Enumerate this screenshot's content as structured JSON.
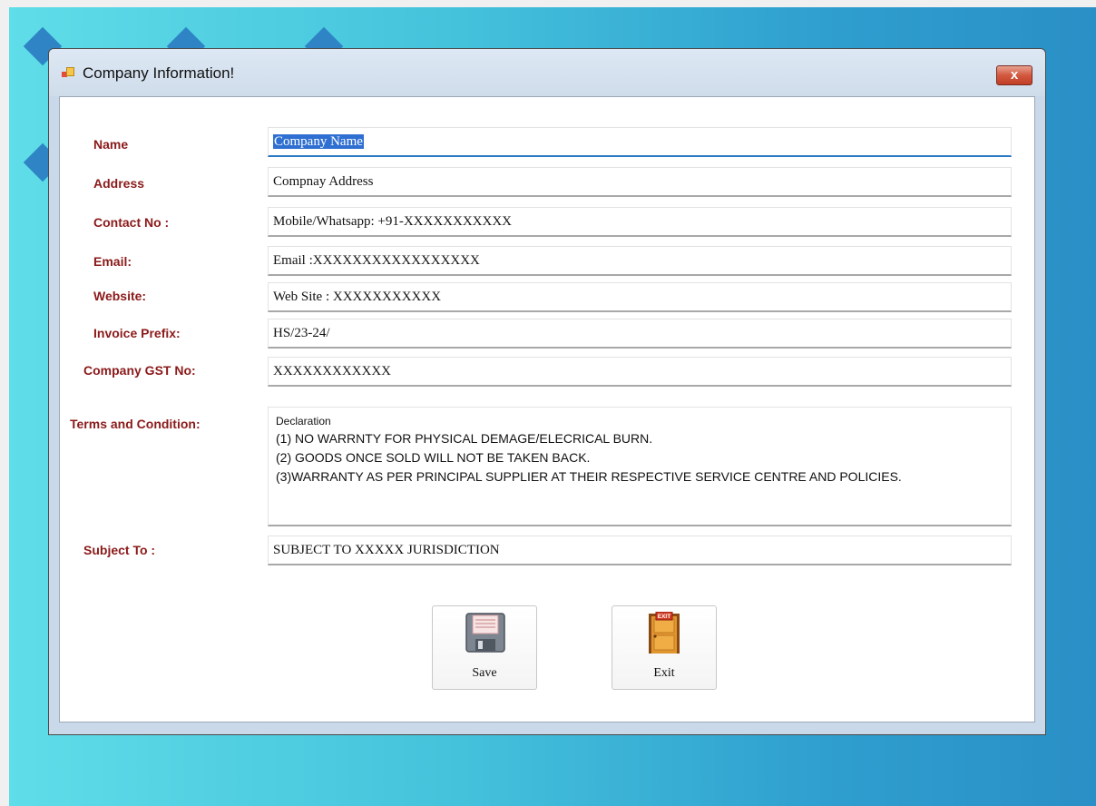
{
  "window": {
    "title": "Company Information!",
    "close_label": "x"
  },
  "form": {
    "name": {
      "label": "Name",
      "value": "Company Name"
    },
    "address": {
      "label": "Address",
      "value": "Compnay Address"
    },
    "contact": {
      "label": "Contact No :",
      "value": "Mobile/Whatsapp: +91-XXXXXXXXXXX"
    },
    "email": {
      "label": "Email:",
      "value": "Email :XXXXXXXXXXXXXXXXX"
    },
    "website": {
      "label": "Website:",
      "value": "Web Site : XXXXXXXXXXX"
    },
    "invoice_prefix": {
      "label": "Invoice Prefix:",
      "value": "HS/23-24/"
    },
    "gst": {
      "label": "Company GST No:",
      "value": "XXXXXXXXXXXX"
    },
    "terms": {
      "label": "Terms and Condition:",
      "lines": [
        "Declaration",
        "(1) NO WARRNTY FOR PHYSICAL DEMAGE/ELECRICAL BURN.",
        "(2) GOODS ONCE SOLD WILL NOT BE TAKEN BACK.",
        "(3)WARRANTY AS PER PRINCIPAL SUPPLIER AT THEIR RESPECTIVE SERVICE CENTRE AND POLICIES."
      ]
    },
    "subject_to": {
      "label": "Subject To :",
      "value": "SUBJECT TO XXXXX JURISDICTION"
    }
  },
  "buttons": {
    "save": {
      "label": "Save",
      "icon": "floppy-disk-icon"
    },
    "exit": {
      "label": "Exit",
      "icon": "exit-door-icon",
      "sign": "EXIT"
    }
  },
  "colors": {
    "label": "#8b1a1a",
    "selection": "#2f6fd1",
    "close_button": "#c23e26"
  }
}
